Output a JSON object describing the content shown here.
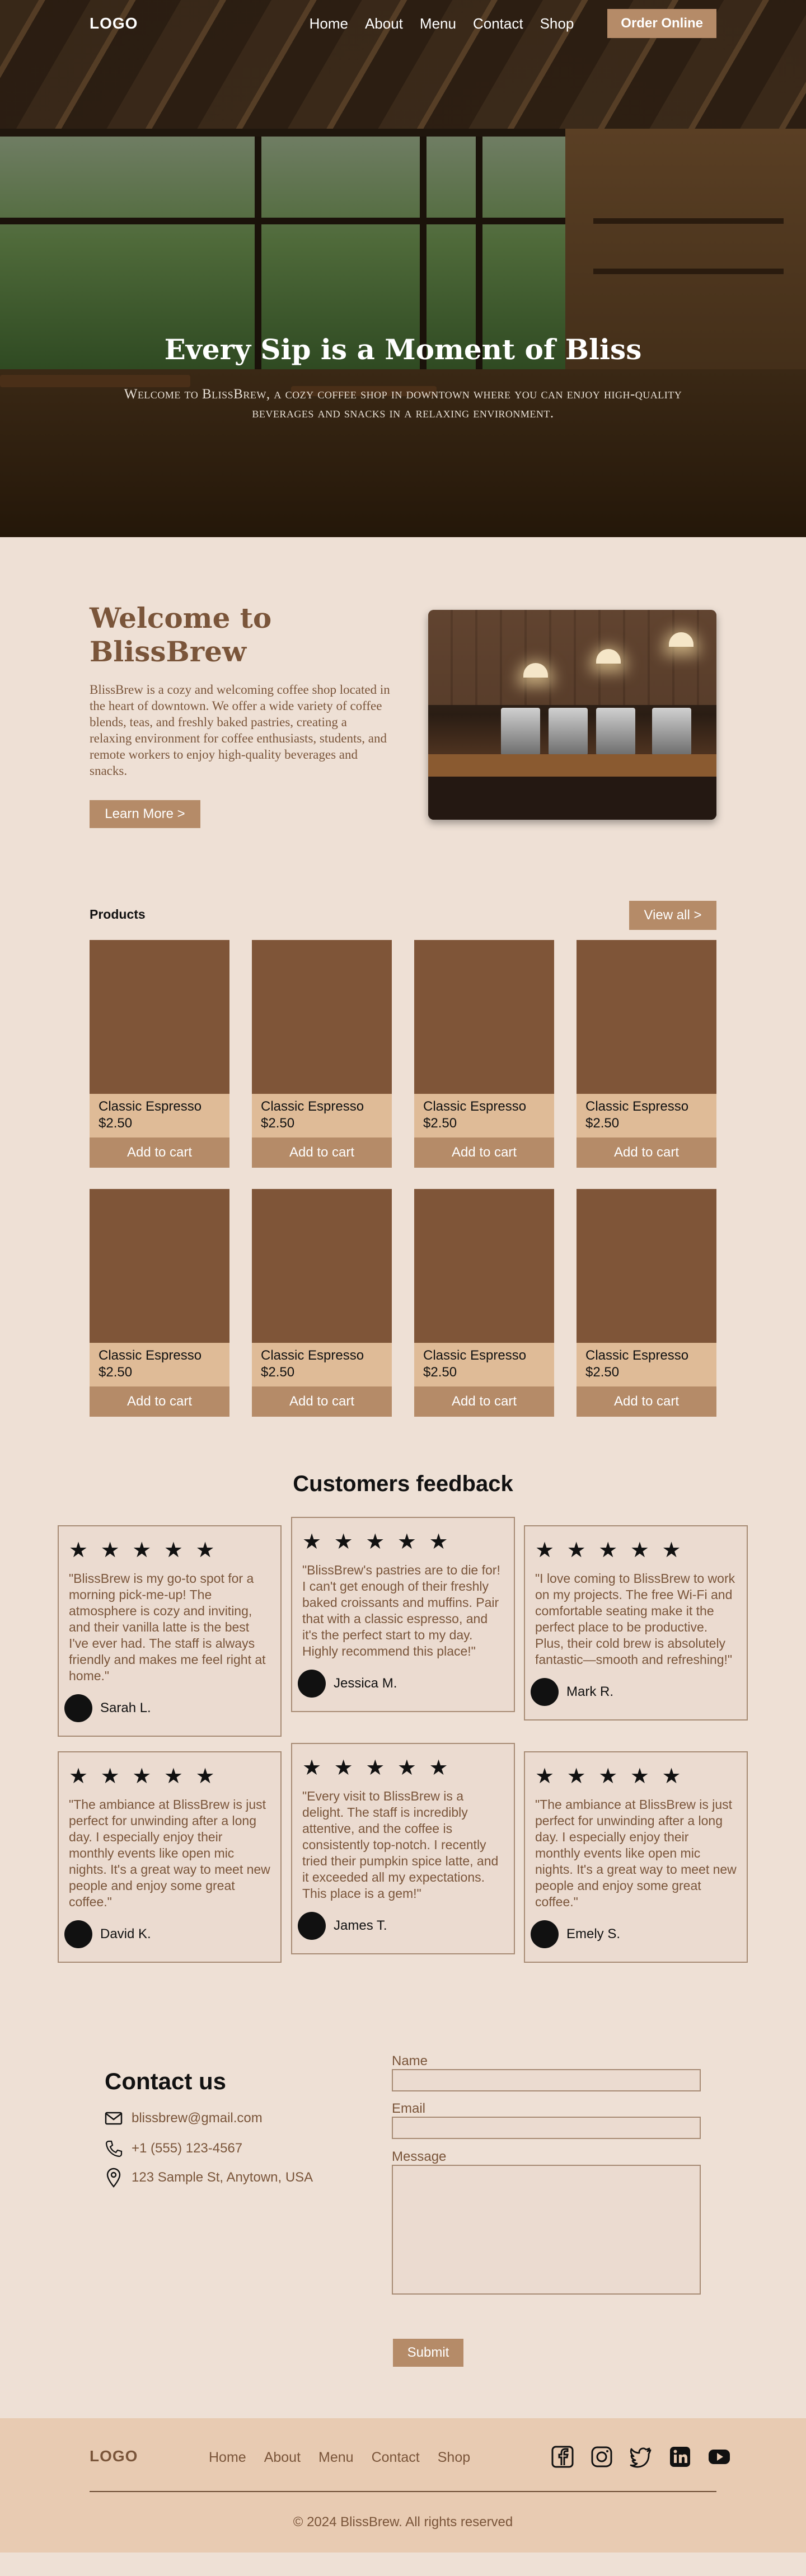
{
  "nav": {
    "logo": "LOGO",
    "links": [
      "Home",
      "About",
      "Menu",
      "Contact",
      "Shop"
    ],
    "cta": "Order Online"
  },
  "hero": {
    "title": "Every Sip is a Moment of Bliss",
    "subtitle": "Welcome to BlissBrew, a cozy coffee shop in downtown where you can enjoy high-quality beverages and snacks in a relaxing environment."
  },
  "welcome": {
    "title": "Welcome to BlissBrew",
    "body": "BlissBrew is a cozy and welcoming coffee shop located in the heart of downtown. We offer a wide variety of coffee blends, teas, and freshly baked pastries, creating a relaxing environment for coffee enthusiasts, students, and remote workers to enjoy high-quality beverages and snacks.",
    "button": "Learn More >"
  },
  "products": {
    "title": "Products",
    "view_all": "View all >",
    "items": [
      {
        "name": "Classic Espresso",
        "price": "$2.50",
        "button": "Add to cart"
      },
      {
        "name": "Classic Espresso",
        "price": "$2.50",
        "button": "Add to cart"
      },
      {
        "name": "Classic Espresso",
        "price": "$2.50",
        "button": "Add to cart"
      },
      {
        "name": "Classic Espresso",
        "price": "$2.50",
        "button": "Add to cart"
      },
      {
        "name": "Classic Espresso",
        "price": "$2.50",
        "button": "Add to cart"
      },
      {
        "name": "Classic Espresso",
        "price": "$2.50",
        "button": "Add to cart"
      },
      {
        "name": "Classic Espresso",
        "price": "$2.50",
        "button": "Add to cart"
      },
      {
        "name": "Classic Espresso",
        "price": "$2.50",
        "button": "Add to cart"
      }
    ]
  },
  "feedback": {
    "title": "Customers feedback",
    "stars": "★ ★ ★ ★ ★",
    "reviews": [
      {
        "quote": "\"BlissBrew is my go-to spot for a morning pick-me-up! The atmosphere is cozy and inviting, and their vanilla latte is the best I've ever had. The staff is always friendly and makes me feel right at home.\"",
        "name": "Sarah L."
      },
      {
        "quote": "\"BlissBrew's pastries are to die for! I can't get enough of their freshly baked croissants and muffins. Pair that with a classic espresso, and it's the perfect start to my day. Highly recommend this place!\"",
        "name": "Jessica M."
      },
      {
        "quote": "\"I love coming to BlissBrew to work on my projects. The free Wi-Fi and comfortable seating make it the perfect place to be productive. Plus, their cold brew is absolutely fantastic—smooth and refreshing!\"",
        "name": "Mark R."
      },
      {
        "quote": "\"The ambiance at BlissBrew is just perfect for unwinding after a long day. I especially enjoy their monthly events like open mic nights. It's a great way to meet new people and enjoy some great coffee.\"",
        "name": "David K."
      },
      {
        "quote": "\"Every visit to BlissBrew is a delight. The staff is incredibly attentive, and the coffee is consistently top-notch. I recently tried their pumpkin spice latte, and it exceeded all my expectations. This place is a gem!\"",
        "name": "James T."
      },
      {
        "quote": "\"The ambiance at BlissBrew is just perfect for unwinding after a long day. I especially enjoy their monthly events like open mic nights. It's a great way to meet new people and enjoy some great coffee.\"",
        "name": "Emely S."
      }
    ]
  },
  "contact": {
    "title": "Contact us",
    "email": "blissbrew@gmail.com",
    "phone": "+1 (555) 123-4567",
    "address": "123 Sample St, Anytown, USA",
    "form": {
      "name_label": "Name",
      "email_label": "Email",
      "message_label": "Message",
      "submit": "Submit"
    }
  },
  "footer": {
    "logo": "LOGO",
    "links": [
      "Home",
      "About",
      "Menu",
      "Contact",
      "Shop"
    ],
    "socials": [
      "facebook-icon",
      "instagram-icon",
      "twitter-icon",
      "linkedin-icon",
      "youtube-icon"
    ],
    "copyright": "© 2024 BlissBrew. All rights reserved"
  },
  "colors": {
    "accent": "#b58b68",
    "brown_text": "#7a553a",
    "page_bg": "#eee0d5",
    "product_card": "#dfbb97",
    "product_image": "#7f5538",
    "footer_bg": "#e8cbb2"
  }
}
